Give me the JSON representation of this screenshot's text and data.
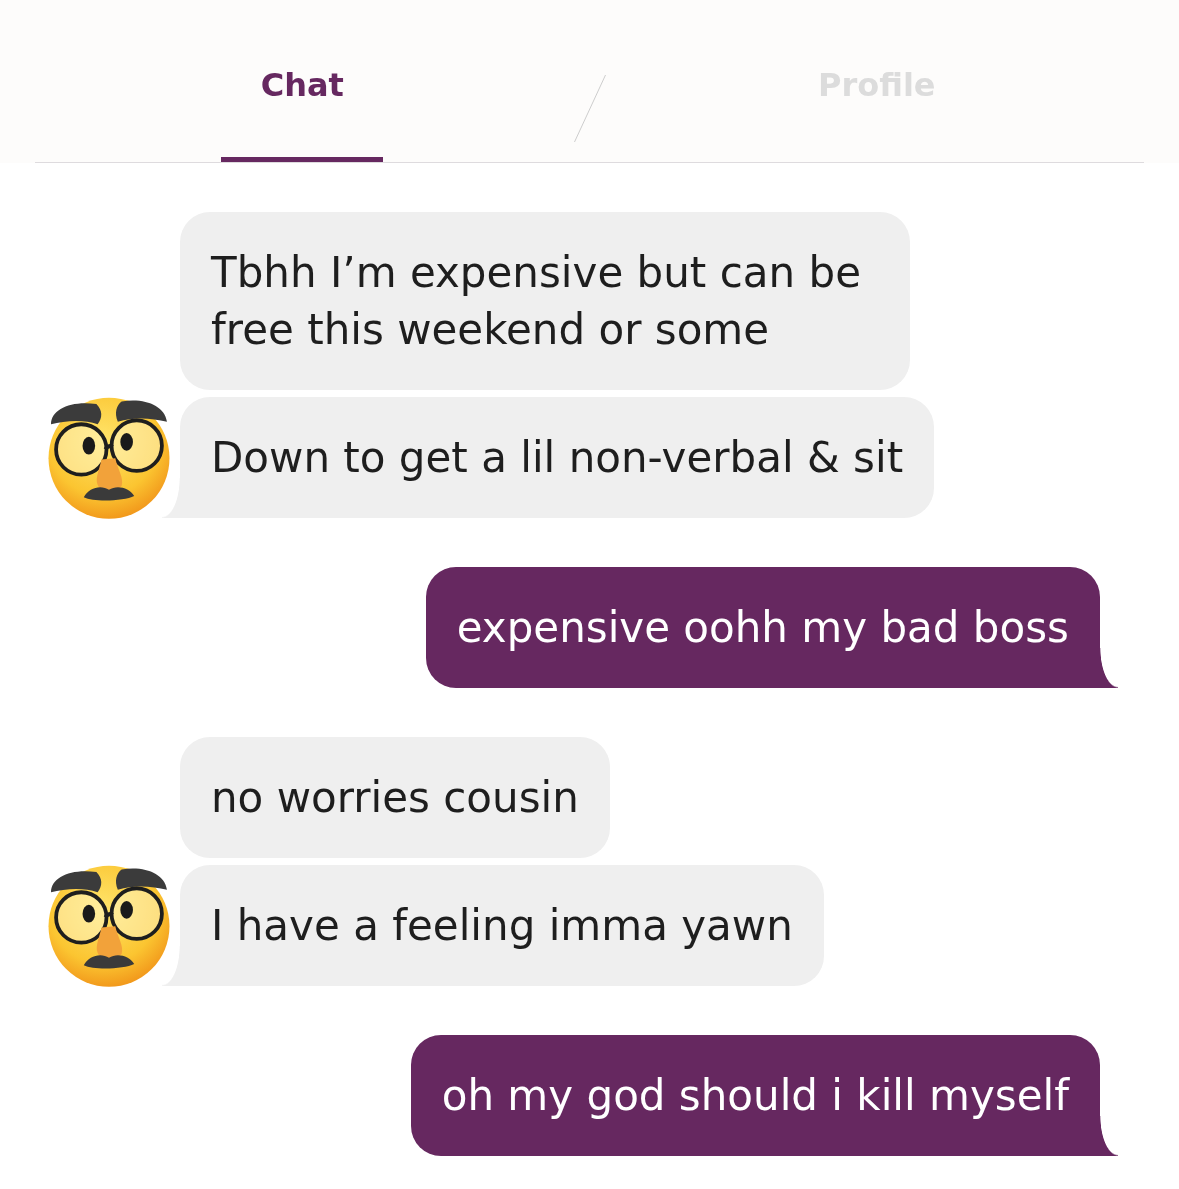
{
  "tabs": [
    {
      "label": "Chat",
      "selected": true
    },
    {
      "label": "Profile",
      "selected": false
    }
  ],
  "groups": [
    {
      "kind": "received",
      "bubbles": [
        "Tbhh I’m expensive but can be free this weekend or some",
        "Down to get a lil non-verbal & sit"
      ]
    },
    {
      "kind": "sent",
      "bubbles": [
        "expensive oohh my bad boss"
      ]
    },
    {
      "kind": "received",
      "bubbles": [
        "no worries cousin",
        "I have a feeling imma yawn"
      ]
    },
    {
      "kind": "sent",
      "bubbles": [
        "oh my god should i kill myself"
      ]
    }
  ]
}
